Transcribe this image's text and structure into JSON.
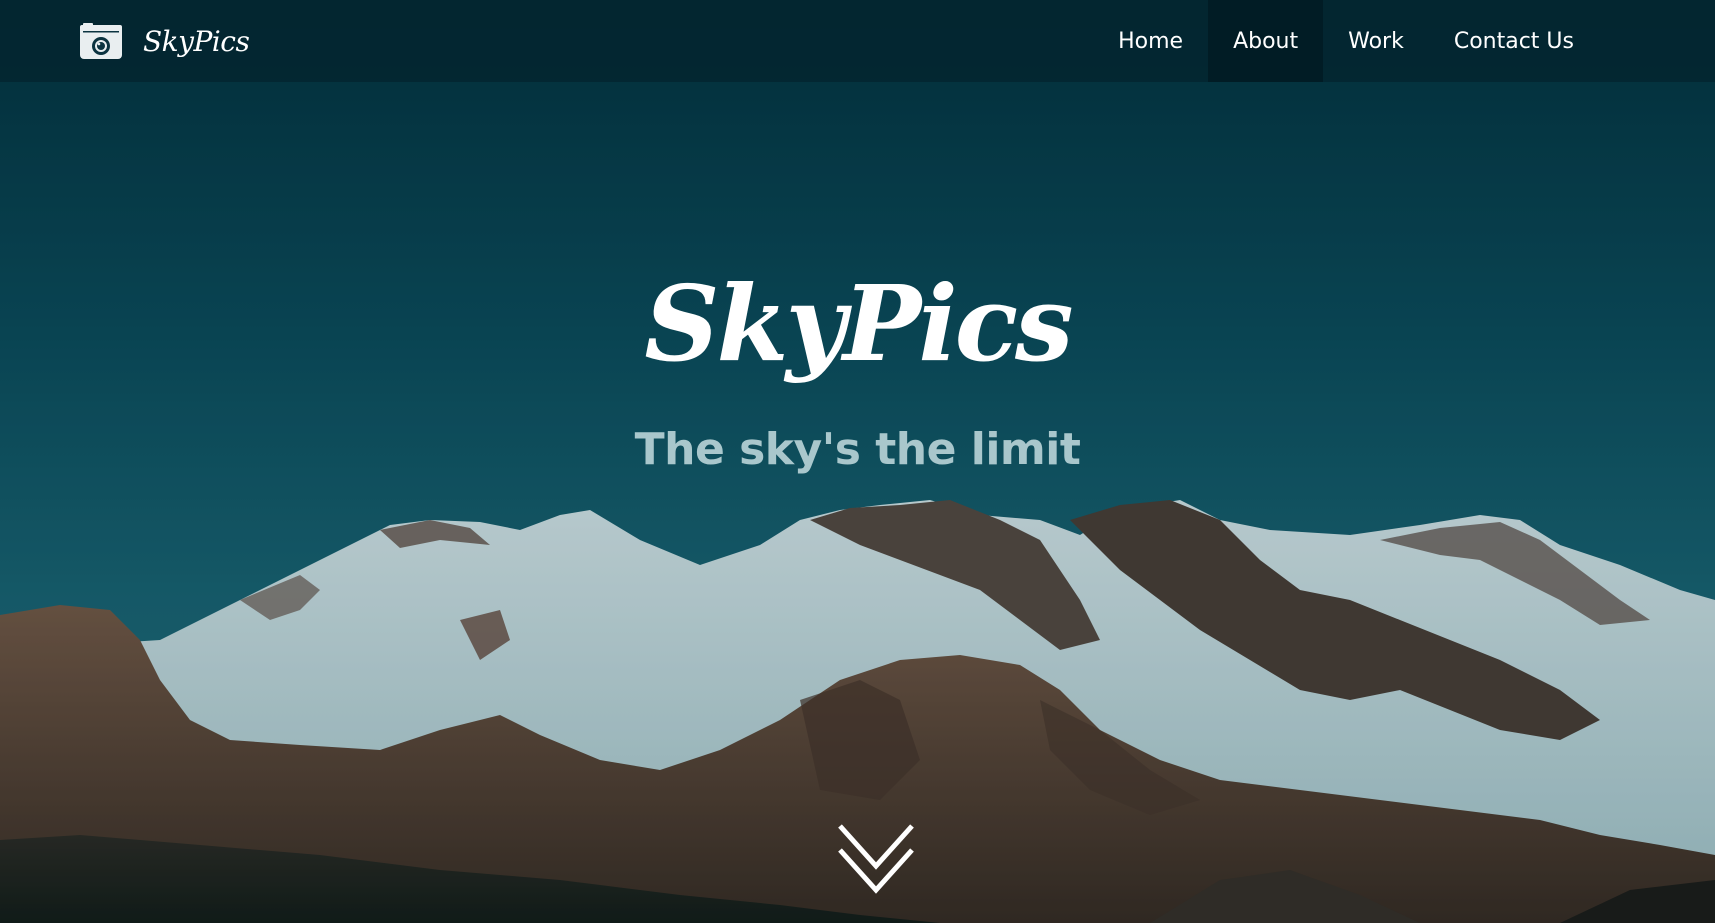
{
  "navbar": {
    "brand_name": "SkyPics",
    "brand_icon": "camera-icon",
    "items": [
      {
        "label": "Home",
        "active": false
      },
      {
        "label": "About",
        "active": true
      },
      {
        "label": "Work",
        "active": false
      },
      {
        "label": "Contact Us",
        "active": false
      }
    ]
  },
  "hero": {
    "title": "SkyPics",
    "tagline": "The sky's the limit",
    "scroll_icon": "double-chevron-down-icon",
    "background": "mountain-landscape-image"
  },
  "colors": {
    "navbar_bg": "#04242e",
    "nav_active_bg": "#021a22",
    "sky_top": "#05414f",
    "sky_bottom": "#1e6a78",
    "tagline": "#a9c7cc",
    "text": "#ffffff"
  }
}
